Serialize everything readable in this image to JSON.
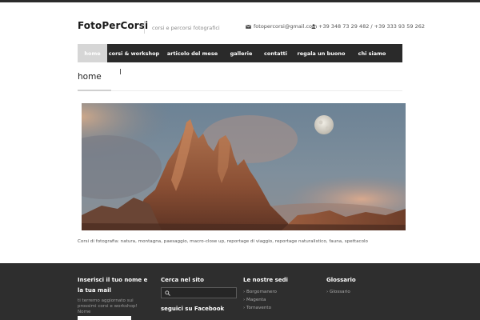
{
  "header": {
    "site_title": "FotoPerCorsi",
    "tagline": "corsi e percorsi fotografici",
    "email": "fotopercorsi@gmail.com",
    "phone": "+39 348 73 29 482 / +39 333 93 59 262"
  },
  "nav": {
    "items": [
      {
        "label": "home",
        "active": true
      },
      {
        "label": "corsi & workshop"
      },
      {
        "label": "articolo del mese"
      },
      {
        "label": "gallerie"
      },
      {
        "label": "contatti"
      },
      {
        "label": "regala un buono"
      },
      {
        "label": "chi siamo"
      }
    ]
  },
  "page": {
    "title": "home",
    "caption": "Corsi di fotografia: natura, montagna, paesaggio, macro-close up, reportage di viaggio, reportage naturalistico, fauna, spettacolo"
  },
  "footer": {
    "newsletter": {
      "heading": "Inserisci il tuo nome e la tua mail",
      "text": "ti terremo aggiornato sui prossimi corsi e workshop!",
      "name_label": "Nome"
    },
    "search": {
      "heading": "Cerca nel sito",
      "facebook_heading": "seguici su Facebook"
    },
    "locations": {
      "heading": "Le nostre sedi",
      "items": [
        "Borgomanero",
        "Magenta",
        "Tornavento"
      ]
    },
    "glossary": {
      "heading": "Glossario",
      "items": [
        "Glossario"
      ]
    }
  },
  "colors": {
    "nav_bg": "#2a2a2a",
    "nav_active": "#d6d6d6",
    "footer_bg": "#2e2e2e"
  }
}
